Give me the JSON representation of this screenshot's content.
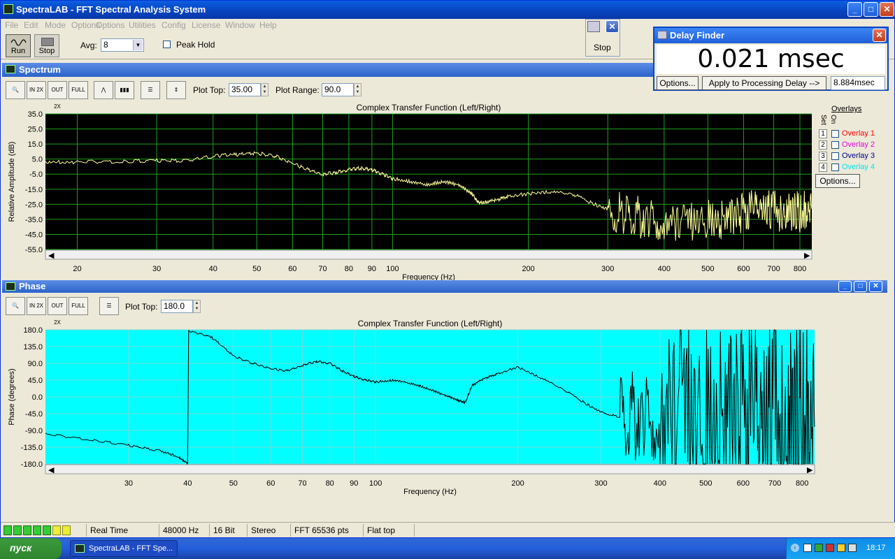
{
  "window": {
    "title": "SpectraLAB - FFT Spectral Analysis System"
  },
  "menu": [
    "File",
    "Edit",
    "Mode",
    "Options",
    "Utilities",
    "Config",
    "License",
    "Window",
    "Help"
  ],
  "toolbar": {
    "run_label": "Run",
    "stop_label": "Stop",
    "avg_label": "Avg:",
    "avg_value": "8",
    "peak_hold_label": "Peak Hold",
    "peak_hold_checked": false
  },
  "stop_window": {
    "stop_label": "Stop"
  },
  "delay_finder": {
    "title": "Delay Finder",
    "value": "0.021 msec",
    "options_label": "Options...",
    "apply_label": "Apply to Processing Delay -->",
    "delay_input": "8.884",
    "delay_unit": "msec"
  },
  "spectrum": {
    "pane_title": "Spectrum",
    "plot_top_label": "Plot Top:",
    "plot_top_value": "35.00",
    "plot_range_label": "Plot Range:",
    "plot_range_value": "90.0",
    "overlays_title": "Overlays",
    "set_label": "Set",
    "on_label": "On",
    "overlays": [
      {
        "num": "1",
        "label": "Overlay 1",
        "color": "#ff0000"
      },
      {
        "num": "2",
        "label": "Overlay 2",
        "color": "#e000e0"
      },
      {
        "num": "3",
        "label": "Overlay 3",
        "color": "#00008b"
      },
      {
        "num": "4",
        "label": "Overlay 4",
        "color": "#00e5ee"
      }
    ],
    "overlays_options_label": "Options..."
  },
  "phase": {
    "pane_title": "Phase",
    "plot_top_label": "Plot Top:",
    "plot_top_value": "180.0"
  },
  "chart_data": [
    {
      "type": "line",
      "title": "Complex Transfer Function (Left/Right)",
      "xlabel": "Frequency (Hz)",
      "ylabel": "Relative Amplitude (dB)",
      "x_scale": "log",
      "xlim": [
        17,
        850
      ],
      "ylim": [
        -55,
        35
      ],
      "x_ticks": [
        "20",
        "30",
        "40",
        "50",
        "60",
        "70",
        "80",
        "90",
        "100",
        "200",
        "300",
        "400",
        "500",
        "600",
        "700",
        "800"
      ],
      "y_ticks": [
        "35.0",
        "25.0",
        "15.0",
        "5.0",
        "-5.0",
        "-15.0",
        "-25.0",
        "-35.0",
        "-45.0",
        "-55.0"
      ],
      "background": "#000000",
      "grid": true,
      "grid_color": "#1e9e1e",
      "series": [
        {
          "color": "#ffff99",
          "x": [
            17,
            20,
            25,
            30,
            35,
            40,
            45,
            50,
            55,
            60,
            65,
            70,
            75,
            80,
            85,
            90,
            95,
            100,
            110,
            120,
            130,
            140,
            150,
            155,
            160,
            170,
            180,
            200,
            220,
            250,
            280,
            300,
            330,
            360,
            400,
            450,
            500,
            550,
            600,
            650,
            700,
            750,
            800,
            850
          ],
          "y": [
            3,
            3,
            3.5,
            4,
            4,
            7,
            8,
            9,
            7,
            2,
            -2,
            -5,
            -4,
            -2,
            -1,
            -2,
            -5,
            -8,
            -10,
            -12,
            -10,
            -12,
            -18,
            -24,
            -24,
            -22,
            -20,
            -18,
            -17,
            -18,
            -25,
            -28,
            -32,
            -34,
            -36,
            -38,
            -35,
            -34,
            -30,
            -28,
            -30,
            -29,
            -30,
            -28
          ]
        }
      ]
    },
    {
      "type": "line",
      "title": "Complex Transfer Function (Left/Right)",
      "xlabel": "Frequency (Hz)",
      "ylabel": "Phase (degrees)",
      "x_scale": "log",
      "xlim": [
        20,
        850
      ],
      "ylim": [
        -180,
        180
      ],
      "x_ticks": [
        "30",
        "40",
        "50",
        "60",
        "70",
        "80",
        "90",
        "100",
        "200",
        "300",
        "400",
        "500",
        "600",
        "700",
        "800"
      ],
      "y_ticks": [
        "180.0",
        "135.0",
        "90.0",
        "45.0",
        "0.0",
        "-45.0",
        "-90.0",
        "-135.0",
        "-180.0"
      ],
      "background": "#00ffff",
      "grid": true,
      "grid_color": "#7ad8d8",
      "series": [
        {
          "color": "#000000",
          "x": [
            20,
            25,
            30,
            35,
            38,
            40,
            40.2,
            45,
            50,
            55,
            60,
            65,
            70,
            75,
            80,
            85,
            90,
            95,
            100,
            110,
            120,
            130,
            140,
            150,
            155,
            160,
            170,
            180,
            200,
            220,
            250,
            280,
            300,
            330,
            360,
            400,
            450,
            500,
            550,
            600,
            650,
            700,
            750,
            800,
            850
          ],
          "y": [
            -100,
            -115,
            -130,
            -145,
            -160,
            -178,
            178,
            160,
            110,
            90,
            75,
            70,
            85,
            95,
            90,
            70,
            55,
            45,
            40,
            45,
            35,
            20,
            5,
            -10,
            -15,
            30,
            50,
            60,
            80,
            55,
            20,
            -20,
            -40,
            -55,
            -50,
            -60,
            -80,
            -90,
            -70,
            -60,
            -75,
            -90,
            -70,
            -60,
            -80
          ]
        }
      ]
    }
  ],
  "status": {
    "mode": "Real Time",
    "rate": "48000 Hz",
    "bits": "16 Bit",
    "channels": "Stereo",
    "fft": "FFT 65536 pts",
    "window": "Flat top"
  },
  "taskbar": {
    "start_label": "пуск",
    "task_label": "SpectraLAB - FFT Spe...",
    "clock": "18:17"
  }
}
